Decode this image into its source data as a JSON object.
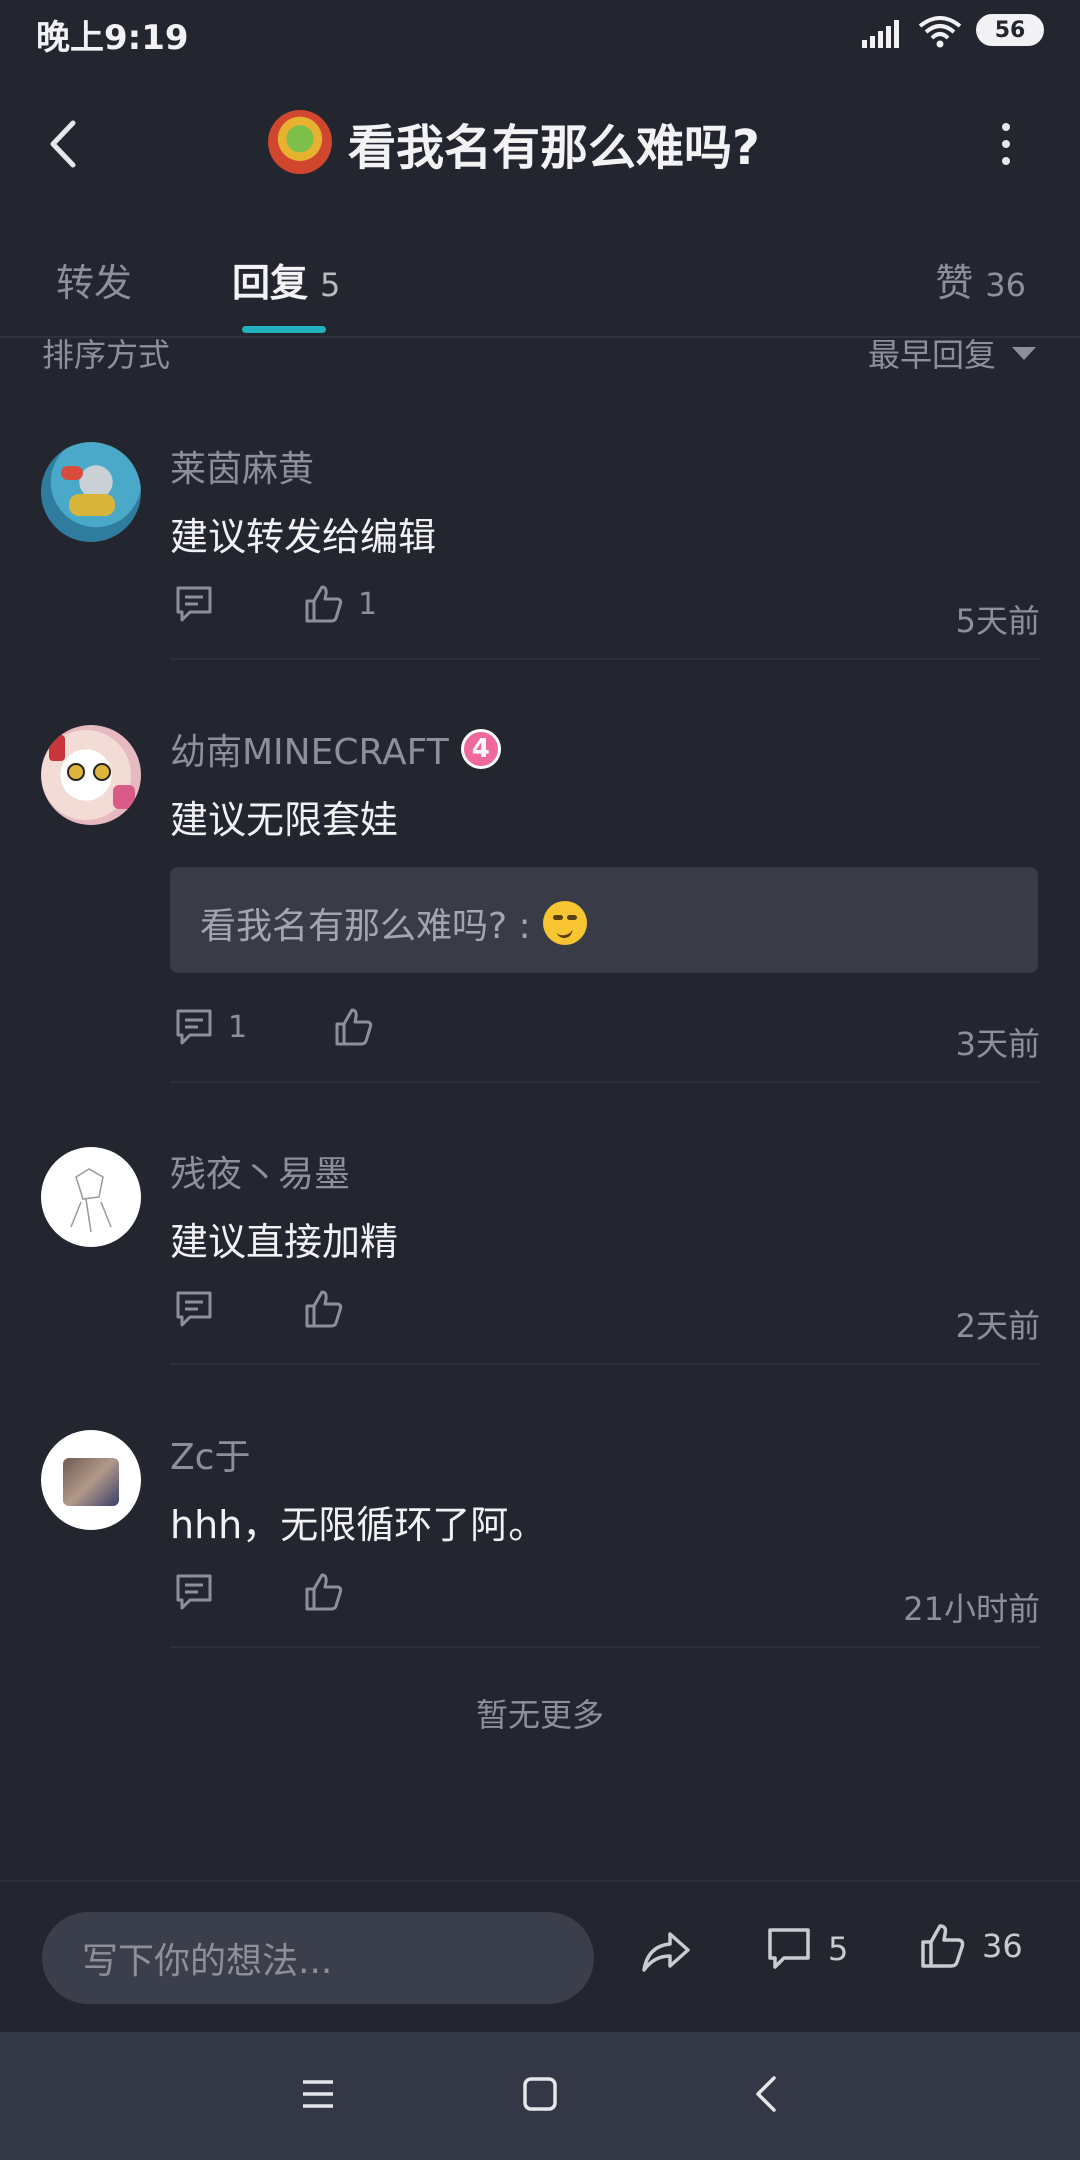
{
  "status_bar": {
    "time": "晚上9:19",
    "battery": "56"
  },
  "header": {
    "title": "看我名有那么难吗?"
  },
  "tabs": {
    "forward_label": "转发",
    "reply_label": "回复",
    "reply_count": "5",
    "like_label": "赞",
    "like_count": "36"
  },
  "sort": {
    "label": "排序方式",
    "value": "最早回复"
  },
  "comments": [
    {
      "name": "莱茵麻黄",
      "text": "建议转发给编辑",
      "reply_count": "",
      "like_count": "1",
      "time": "5天前"
    },
    {
      "name": "幼南MINECRAFT",
      "badge": "4",
      "text": "建议无限套娃",
      "quote": "看我名有那么难吗? :",
      "reply_count": "1",
      "like_count": "",
      "time": "3天前"
    },
    {
      "name": "残夜丶易墨",
      "text": "建议直接加精",
      "reply_count": "",
      "like_count": "",
      "time": "2天前"
    },
    {
      "name": "Zc于",
      "text": "hhh，无限循环了阿。",
      "reply_count": "",
      "like_count": "",
      "time": "21小时前"
    }
  ],
  "footer_note": "暂无更多",
  "bottom_bar": {
    "input_placeholder": "写下你的想法...",
    "comment_count": "5",
    "like_count": "36"
  },
  "colors": {
    "background": "#23252f",
    "accent": "#22b0bc",
    "badge": "#ef6a9a"
  }
}
